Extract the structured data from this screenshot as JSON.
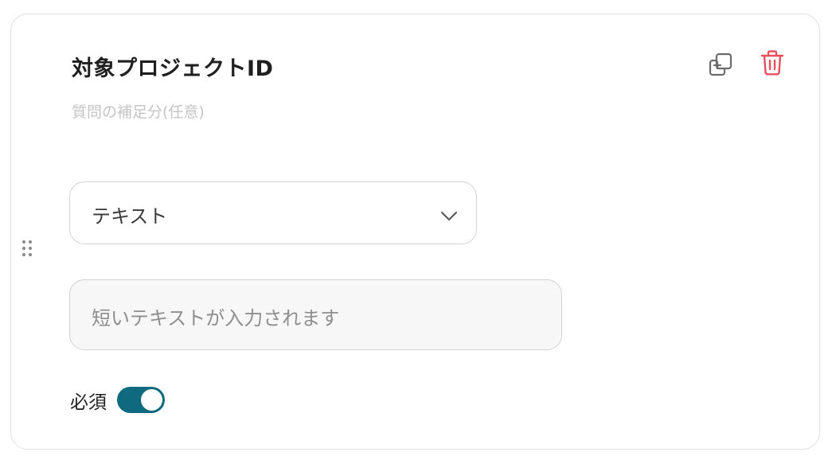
{
  "question": {
    "title": "対象プロジェクトID",
    "description_placeholder": "質問の補足分(任意)"
  },
  "answer_type": {
    "selected": "テキスト"
  },
  "answer_preview": {
    "placeholder": "短いテキストが入力されます"
  },
  "required": {
    "label": "必須",
    "enabled": true
  },
  "icons": {
    "copy": "copy-icon",
    "delete": "trash-icon",
    "chevron": "chevron-down-icon",
    "drag": "drag-handle-icon"
  },
  "colors": {
    "delete": "#e8505b",
    "toggle_on": "#0f6a7f"
  }
}
